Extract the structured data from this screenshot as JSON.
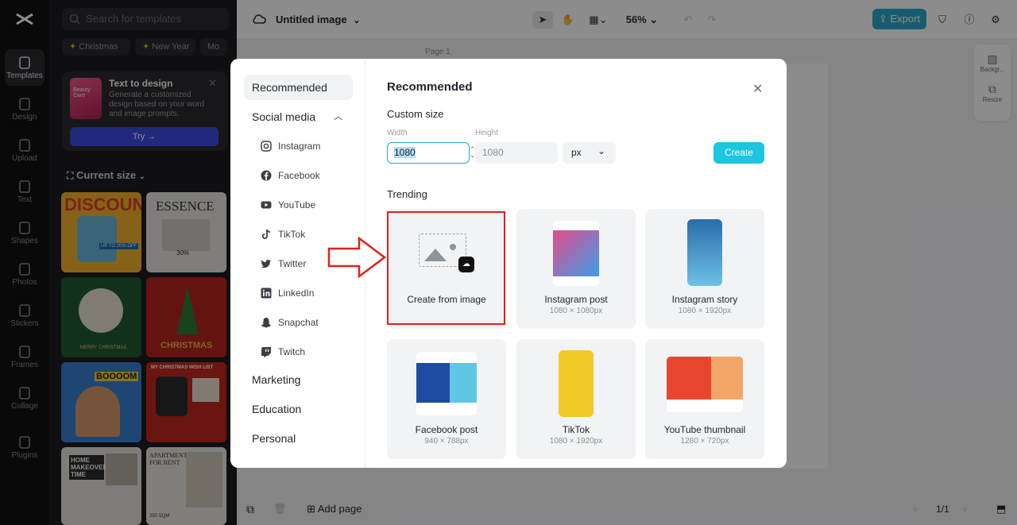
{
  "colors": {
    "accent": "#1bc6e0",
    "export": "#2aa8c9",
    "highlight": "#e2201c"
  },
  "rail": {
    "items": [
      {
        "label": "Templates",
        "icon": "templates-icon"
      },
      {
        "label": "Design",
        "icon": "design-icon"
      },
      {
        "label": "Upload",
        "icon": "upload-icon"
      },
      {
        "label": "Text",
        "icon": "text-icon"
      },
      {
        "label": "Shapes",
        "icon": "shapes-icon"
      },
      {
        "label": "Photos",
        "icon": "photos-icon"
      },
      {
        "label": "Stickers",
        "icon": "stickers-icon"
      },
      {
        "label": "Frames",
        "icon": "frames-icon"
      },
      {
        "label": "Collage",
        "icon": "collage-icon"
      },
      {
        "label": "Plugins",
        "icon": "plugins-icon"
      }
    ]
  },
  "templates": {
    "search_placeholder": "Search for templates",
    "chips": [
      "Christmas",
      "New Year",
      "Mo"
    ],
    "promo": {
      "title": "Text to design",
      "desc": "Generate a customized design based on your word and image prompts.",
      "try": "Try →",
      "thumb_text": "Beauty Care"
    },
    "current_size": "Current size",
    "cards": [
      {
        "text": "DISCOUNT",
        "sub": "UP TO 20% OFF"
      },
      {
        "text": "ESSENCE",
        "sub": "30%"
      },
      {
        "text": "",
        "sub": "MERRY CHRISTMAS"
      },
      {
        "text": "",
        "sub": "CHRISTMAS"
      },
      {
        "text": "BOOOOM",
        "sub": ""
      },
      {
        "text": "MY CHRISTMAS WISH LIST",
        "sub": ""
      },
      {
        "text": "HOME MAKEOVER TIME",
        "sub": ""
      },
      {
        "text": "APARTMENT FOR RENT",
        "sub": "250 SQM"
      }
    ]
  },
  "topbar": {
    "title": "Untitled image",
    "zoom": "56%",
    "export": "Export"
  },
  "canvas": {
    "page_label": "Page 1",
    "add_page": "Add page",
    "page_count": "1/1",
    "side_tools": [
      "Backgr...",
      "Resize"
    ]
  },
  "modal": {
    "nav": {
      "recommended": "Recommended",
      "social": "Social media",
      "marketing": "Marketing",
      "education": "Education",
      "personal": "Personal"
    },
    "social_items": [
      "Instagram",
      "Facebook",
      "YouTube",
      "TikTok",
      "Twitter",
      "LinkedIn",
      "Snapchat",
      "Twitch"
    ],
    "title": "Recommended",
    "custom_size": "Custom size",
    "width_label": "Width",
    "width_value": "1080",
    "height_label": "Height",
    "height_value": "1080",
    "unit": "px",
    "create": "Create",
    "trending": "Trending",
    "cards": [
      {
        "name": "Create from image",
        "dim": ""
      },
      {
        "name": "Instagram post",
        "dim": "1080 × 1080px"
      },
      {
        "name": "Instagram story",
        "dim": "1080 × 1920px"
      },
      {
        "name": "Facebook post",
        "dim": "940 × 788px"
      },
      {
        "name": "TikTok",
        "dim": "1080 × 1920px"
      },
      {
        "name": "YouTube thumbnail",
        "dim": "1280 × 720px"
      }
    ]
  }
}
